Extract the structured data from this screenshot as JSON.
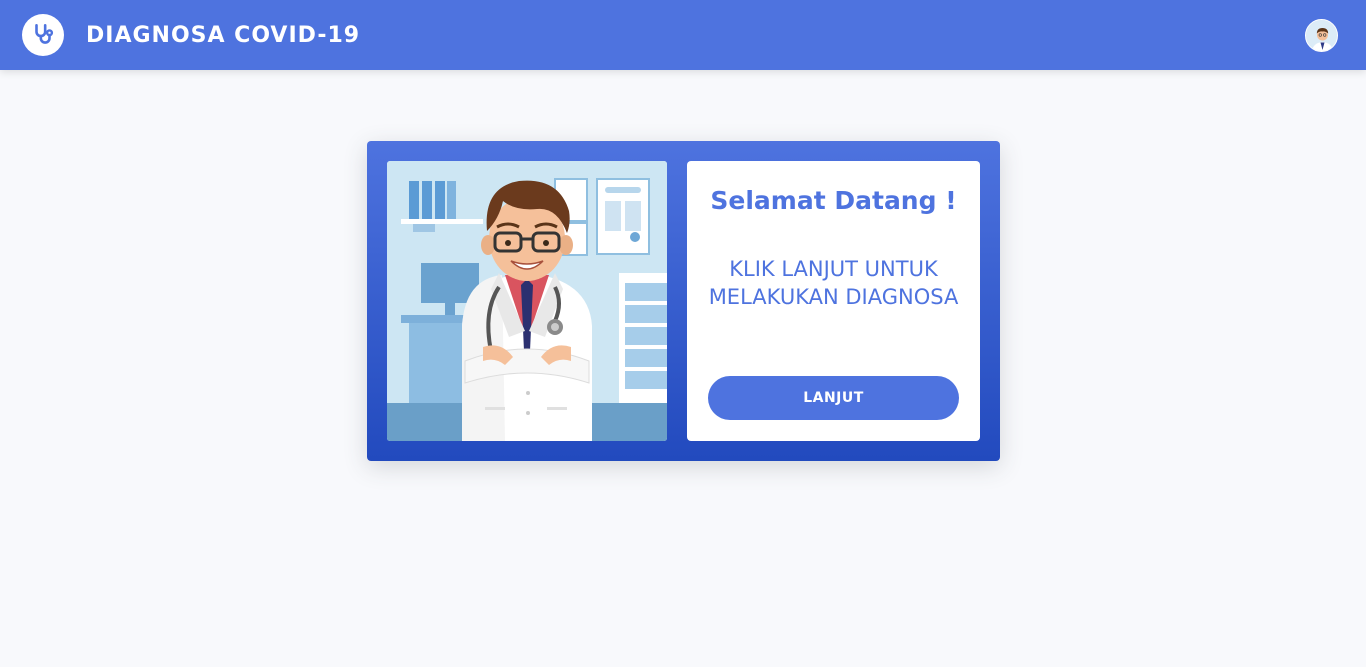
{
  "header": {
    "brand": "DIAGNOSA COVID-19",
    "logo_icon": "stethoscope-icon",
    "avatar_icon": "doctor-avatar-icon"
  },
  "welcome_card": {
    "illustration_icon": "doctor-illustration",
    "title": "Selamat Datang !",
    "instruction": "KLIK LANJUT UNTUK MELAKUKAN DIAGNOSA",
    "button_label": "LANJUT"
  },
  "colors": {
    "primary": "#4e73df",
    "primary_dark": "#224abe",
    "background": "#f8f9fc",
    "white": "#ffffff"
  }
}
